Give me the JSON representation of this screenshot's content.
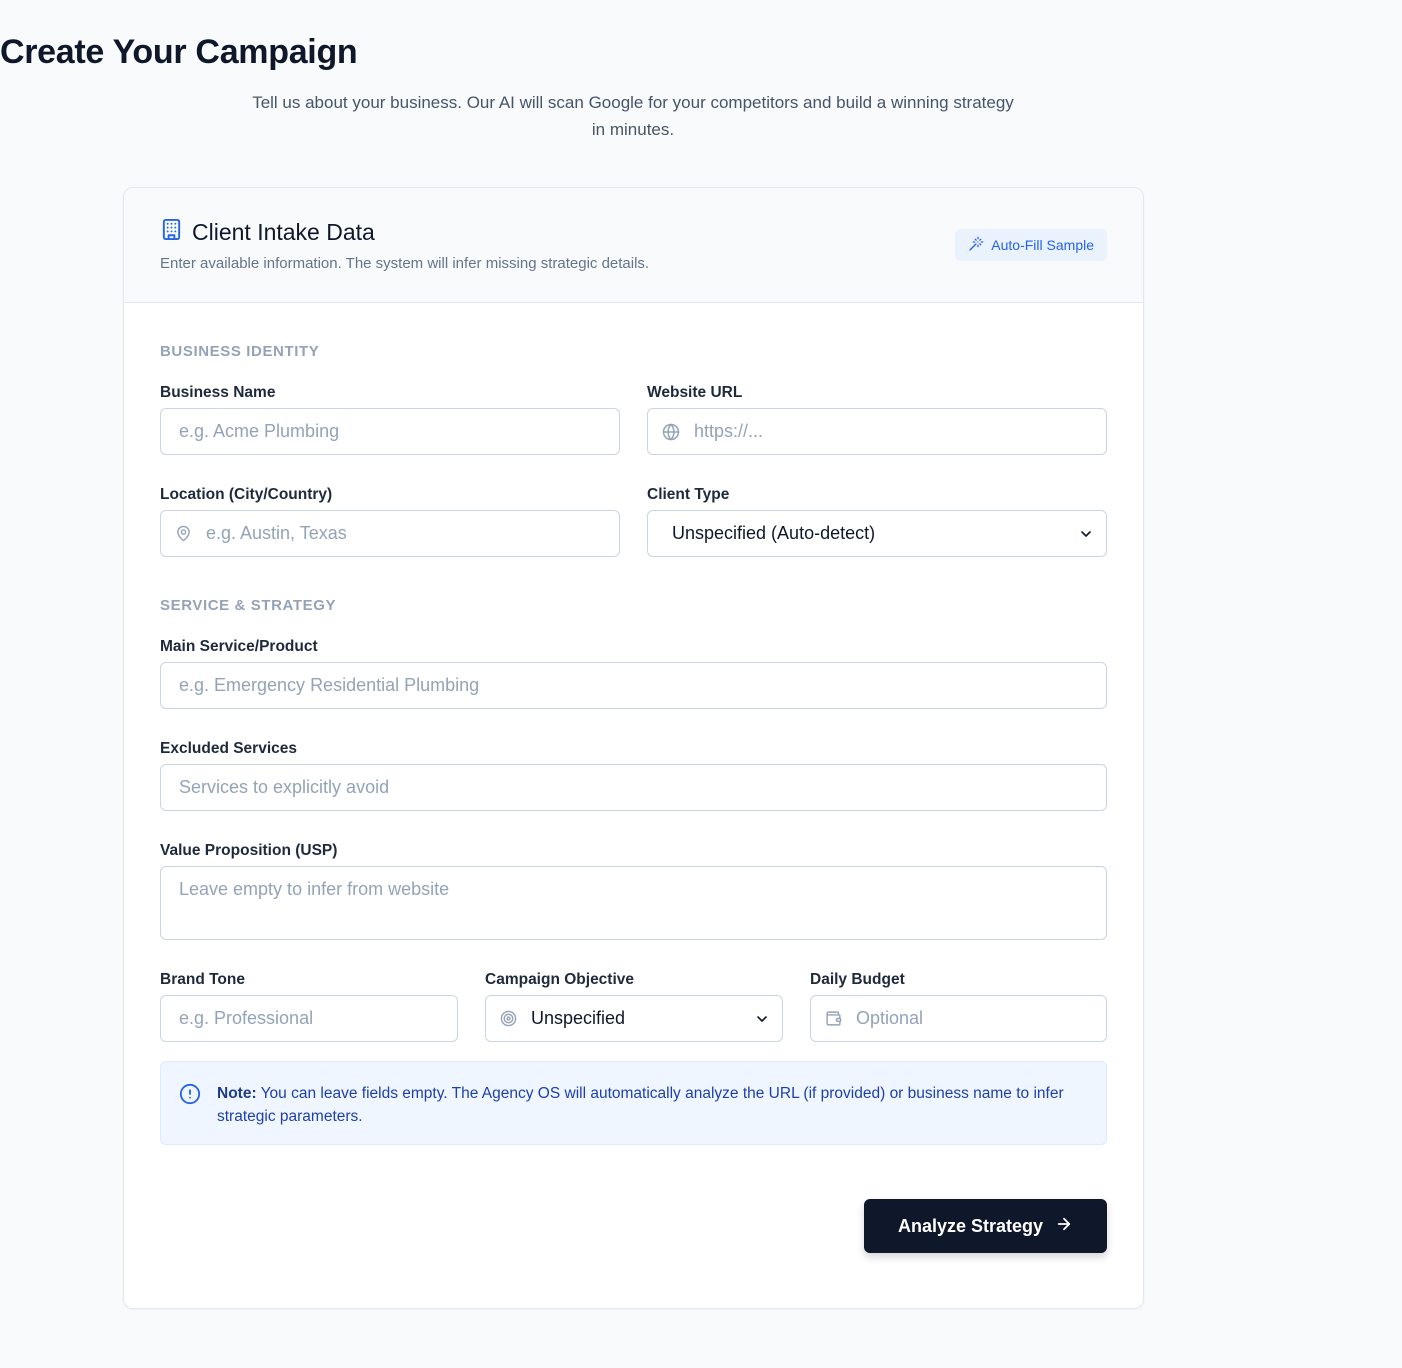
{
  "header": {
    "title": "Create Your Campaign",
    "subtitle": "Tell us about your business. Our AI will scan Google for your competitors and build a winning strategy in minutes."
  },
  "card": {
    "title": "Client Intake Data",
    "description": "Enter available information. The system will infer missing strategic details.",
    "autofill_label": "Auto-Fill Sample"
  },
  "sections": {
    "identity": "BUSINESS IDENTITY",
    "strategy": "SERVICE & STRATEGY"
  },
  "fields": {
    "business_name": {
      "label": "Business Name",
      "placeholder": "e.g. Acme Plumbing"
    },
    "website_url": {
      "label": "Website URL",
      "placeholder": "https://..."
    },
    "location": {
      "label": "Location (City/Country)",
      "placeholder": "e.g. Austin, Texas"
    },
    "client_type": {
      "label": "Client Type",
      "value": "Unspecified (Auto-detect)"
    },
    "main_service": {
      "label": "Main Service/Product",
      "placeholder": "e.g. Emergency Residential Plumbing"
    },
    "excluded_services": {
      "label": "Excluded Services",
      "placeholder": "Services to explicitly avoid"
    },
    "value_proposition": {
      "label": "Value Proposition (USP)",
      "placeholder": "Leave empty to infer from website"
    },
    "brand_tone": {
      "label": "Brand Tone",
      "placeholder": "e.g. Professional"
    },
    "campaign_objective": {
      "label": "Campaign Objective",
      "value": "Unspecified"
    },
    "daily_budget": {
      "label": "Daily Budget",
      "placeholder": "Optional"
    }
  },
  "note": {
    "bold": "Note:",
    "text": " You can leave fields empty. The Agency OS will automatically analyze the URL (if provided) or business name to infer strategic parameters."
  },
  "submit_label": "Analyze Strategy",
  "colors": {
    "accent": "#2563eb",
    "primary_button": "#0f172a",
    "note_bg": "#eff6ff"
  },
  "icons": {
    "card_title": "building-icon",
    "autofill": "magic-wand-icon",
    "website": "globe-icon",
    "location": "map-pin-icon",
    "objective": "target-icon",
    "budget": "wallet-icon",
    "note": "info-icon",
    "submit": "arrow-right-icon",
    "select": "chevron-down-icon"
  }
}
